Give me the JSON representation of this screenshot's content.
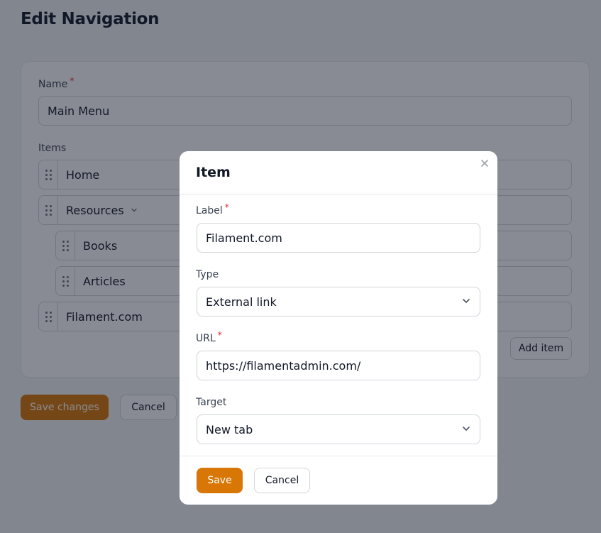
{
  "page": {
    "title": "Edit Navigation"
  },
  "form": {
    "name_label": "Name",
    "name_value": "Main Menu",
    "items_label": "Items",
    "items": [
      {
        "label": "Home",
        "has_children": false
      },
      {
        "label": "Resources",
        "has_children": true
      },
      {
        "label": "Books",
        "has_children": false
      },
      {
        "label": "Articles",
        "has_children": false
      },
      {
        "label": "Filament.com",
        "has_children": false
      }
    ],
    "add_item_label": "Add item",
    "save_changes_label": "Save changes",
    "cancel_label": "Cancel",
    "required_marker": "*"
  },
  "modal": {
    "title": "Item",
    "label_field_label": "Label",
    "label_value": "Filament.com",
    "type_label": "Type",
    "type_value": "External link",
    "url_label": "URL",
    "url_value": "https://filamentadmin.com/",
    "target_label": "Target",
    "target_value": "New tab",
    "save_label": "Save",
    "cancel_label": "Cancel"
  },
  "icons": {
    "close": "close-icon",
    "chevron": "chevron-down-icon",
    "drag": "drag-handle-icon"
  },
  "colors": {
    "primary": "#d97706",
    "required": "#dc2626"
  }
}
